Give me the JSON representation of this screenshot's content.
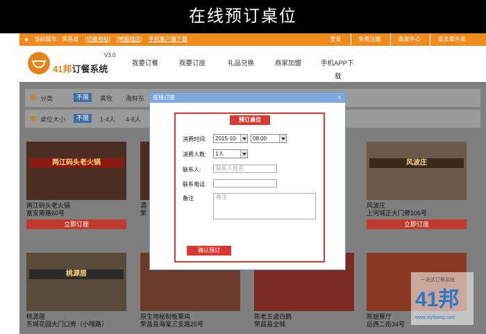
{
  "banner": {
    "title": "在线预订桌位"
  },
  "topbar": {
    "city": "当前城市：荣昌县",
    "switch_city": "[切换地址]",
    "map_search": "[地图找店]",
    "mobile_download": "手机客户端下载",
    "login": "登录",
    "register": "免费注册",
    "merchant_center": "商家中心",
    "takeaway": "谁去拿外卖"
  },
  "logo": {
    "brand_num": "41邦",
    "brand_text": "订餐系统",
    "version": "V3.0"
  },
  "nav": {
    "items": [
      "我要订餐",
      "我要订座",
      "礼品兑换",
      "商家加盟",
      "手机APP下",
      "载"
    ]
  },
  "filters": {
    "category": {
      "label": "分类",
      "selected": "不限",
      "options": [
        "黄牧",
        "海鲜东"
      ]
    },
    "size": {
      "label": "桌位大小",
      "selected": "不限",
      "options": [
        "1-4人",
        "4-8人"
      ]
    }
  },
  "restaurants": [
    {
      "sign": "两江码头老火锅",
      "name": "两江码头老火锅",
      "addr": "富安南路60号",
      "button": "立即订座"
    },
    {
      "sign": "",
      "name": "酒",
      "addr": "荣",
      "button": ""
    },
    {
      "sign": "风波庄",
      "name": "风波庄",
      "addr": "上河城正大门旁106号",
      "button": "立即订座"
    },
    {
      "sign": "桃源居",
      "name": "桃源居",
      "addr": "东城花园大门口旁（小隈路）",
      "button": "立即订座"
    },
    {
      "sign": "",
      "name": "原生地秘制板栗鸡",
      "addr": "荣昌县海棠三支路25号",
      "button": ""
    },
    {
      "sign": "",
      "name": "陈老五卤白鹅",
      "addr": "荣昌县全城",
      "button": ""
    },
    {
      "sign": "",
      "name": "陈姐餐厅",
      "addr": "后西二街34号",
      "button": ""
    }
  ],
  "watermark": {
    "top": "一站式订餐系统",
    "big": "41邦",
    "small": "www.siyibang.com"
  },
  "dialog": {
    "title": "在线订座",
    "close": "×",
    "heading": "预订桌位",
    "time_label": "消费时间:",
    "date_value": "2015-10-",
    "time_value": "08:00",
    "people_label": "消费人数:",
    "people_value": "1人",
    "contact_label": "联系人:",
    "contact_placeholder": "联系人姓名",
    "phone_label": "联系电话:",
    "phone_placeholder": "",
    "note_label": "备注",
    "note_placeholder": "备注",
    "confirm": "确认预订"
  },
  "colors": {
    "accent": "#f08a1d",
    "button": "#c0392b",
    "dialog_border": "#d83a30",
    "dialog_title": "#7ea9de"
  }
}
